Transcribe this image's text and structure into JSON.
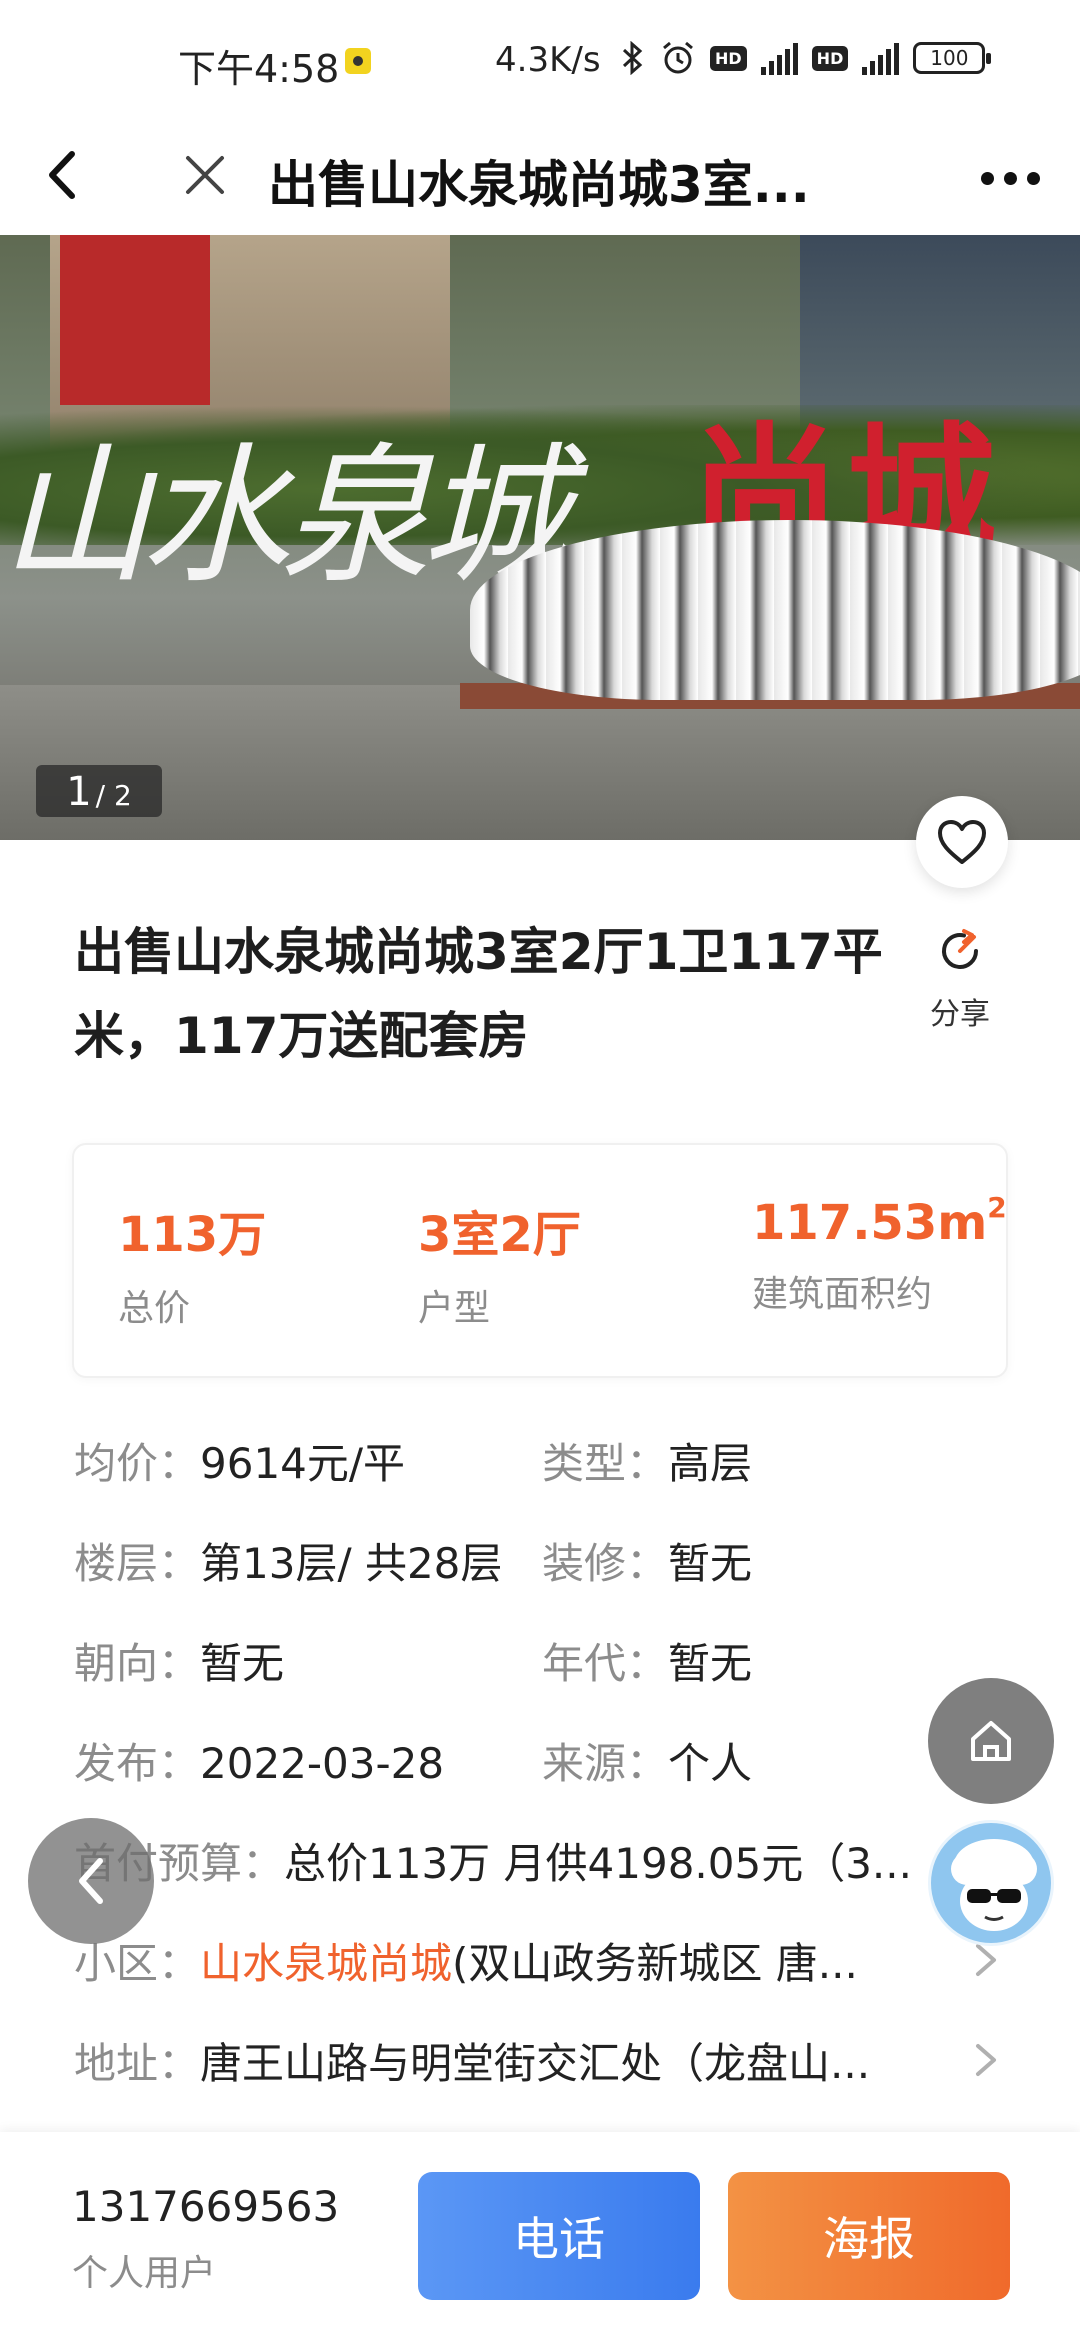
{
  "status_bar": {
    "time": "下午4:58",
    "speed": "4.3K/s",
    "network_1": "4G",
    "network_2": "4G",
    "hd_label": "HD",
    "battery": "100"
  },
  "nav": {
    "title": "出售山水泉城尚城3室...",
    "back_icon": "back-arrow-icon",
    "close_icon": "close-icon",
    "more_icon": "more-dots-icon"
  },
  "gallery": {
    "current": "1",
    "total": "/ 2",
    "photo_sign_red": "尚城",
    "photo_sign_white": "山水泉城"
  },
  "listing": {
    "title": "出售山水泉城尚城3室2厅1卫117平米，117万送配套房",
    "share_label": "分享"
  },
  "stats": [
    {
      "value": "113万",
      "label": "总价"
    },
    {
      "value": "3室2厅",
      "label": "户型"
    },
    {
      "value": "117.53m",
      "sup": "2",
      "label": "建筑面积约"
    }
  ],
  "details": {
    "avg_price_label": "均价：",
    "avg_price": "9614元/平",
    "type_label": "类型：",
    "type": "高层",
    "floor_label": "楼层：",
    "floor": "第13层/ 共28层",
    "decoration_label": "装修：",
    "decoration": "暂无",
    "orientation_label": "朝向：",
    "orientation": "暂无",
    "year_label": "年代：",
    "year": "暂无",
    "publish_label": "发布：",
    "publish": "2022-03-28",
    "source_label": "来源：",
    "source": "个人",
    "budget_label": "首付预算：",
    "budget": "总价113万 月供4198.05元（3...",
    "community_label": "小区：",
    "community_link": "山水泉城尚城",
    "community_extra": "(双山政务新城区 唐...",
    "address_label": "地址：",
    "address": "唐王山路与明堂街交汇处（龙盘山..."
  },
  "bottom": {
    "phone": "1317669563",
    "user_type": "个人用户",
    "call_label": "电话",
    "poster_label": "海报"
  },
  "colors": {
    "accent": "#f0622d",
    "call_button": "#3a7bee",
    "poster_button": "#f06a2b",
    "label_gray": "#8c8c8c"
  }
}
